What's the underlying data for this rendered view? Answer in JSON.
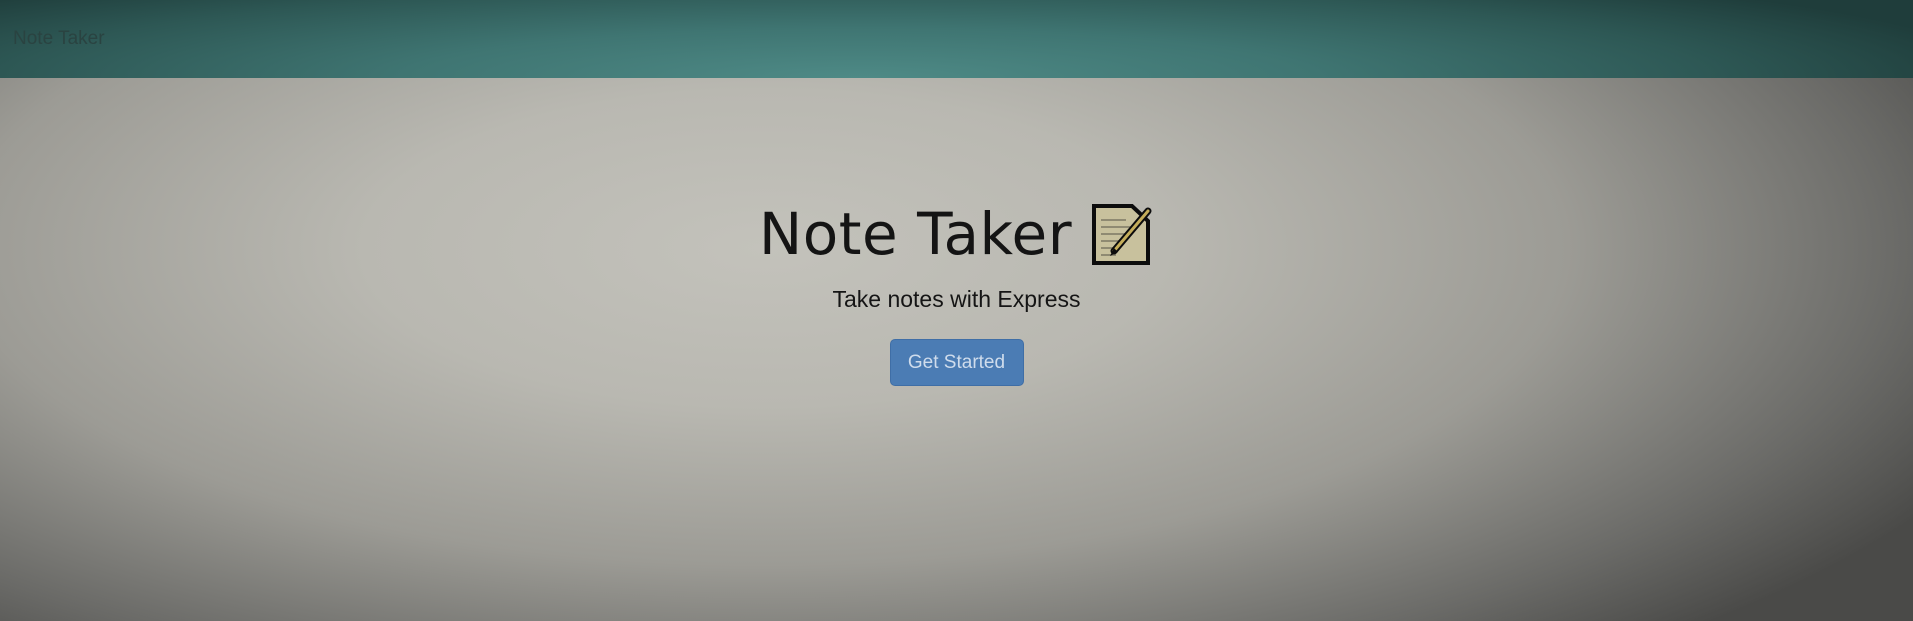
{
  "navbar": {
    "brand": "Note Taker"
  },
  "hero": {
    "title": "Note Taker",
    "icon": "memo-icon",
    "subtitle": "Take notes with Express",
    "cta_label": "Get Started"
  },
  "colors": {
    "navbar": "#3f7572",
    "background": "#bfbeb7",
    "button": "#4b7cb4",
    "button_text": "#cfdcec"
  }
}
